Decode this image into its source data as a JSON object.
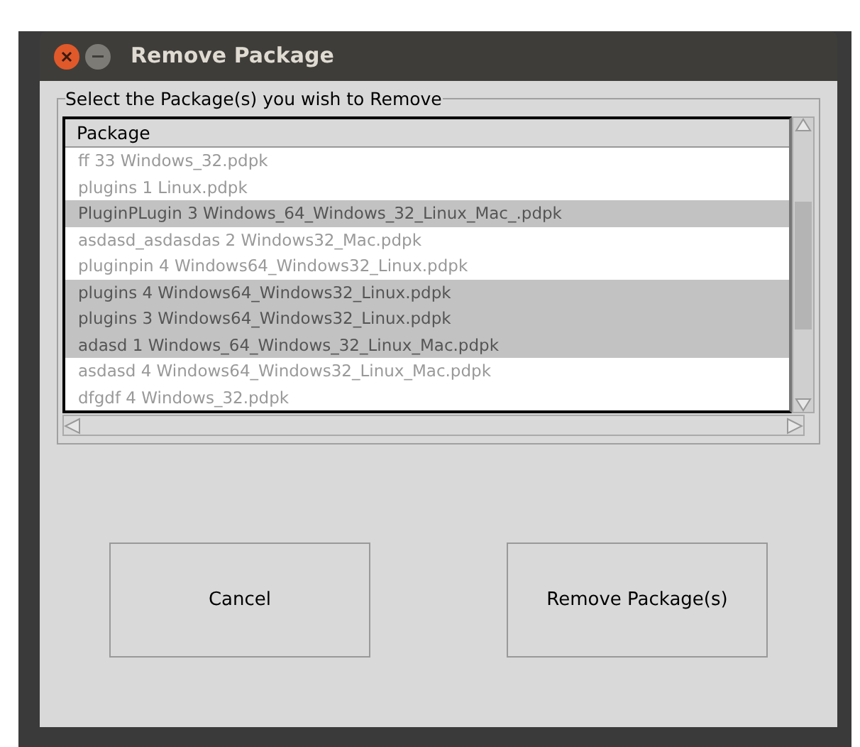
{
  "window": {
    "title": "Remove Package"
  },
  "group": {
    "label": "Select the Package(s) you wish to Remove"
  },
  "list": {
    "column": "Package",
    "rows": [
      {
        "text": "ff 33 Windows_32.pdpk",
        "selected": false
      },
      {
        "text": "plugins 1 Linux.pdpk",
        "selected": false
      },
      {
        "text": "PluginPLugin 3 Windows_64_Windows_32_Linux_Mac_.pdpk",
        "selected": true
      },
      {
        "text": "asdasd_asdasdas 2 Windows32_Mac.pdpk",
        "selected": false
      },
      {
        "text": "pluginpin 4 Windows64_Windows32_Linux.pdpk",
        "selected": false
      },
      {
        "text": "plugins 4 Windows64_Windows32_Linux.pdpk",
        "selected": true
      },
      {
        "text": "plugins 3 Windows64_Windows32_Linux.pdpk",
        "selected": true
      },
      {
        "text": "adasd 1 Windows_64_Windows_32_Linux_Mac.pdpk",
        "selected": true
      },
      {
        "text": "asdasd 4 Windows64_Windows32_Linux_Mac.pdpk",
        "selected": false
      },
      {
        "text": "dfgdf 4 Windows_32.pdpk",
        "selected": false
      }
    ]
  },
  "buttons": [
    "Cancel",
    "Remove Package(s)"
  ]
}
